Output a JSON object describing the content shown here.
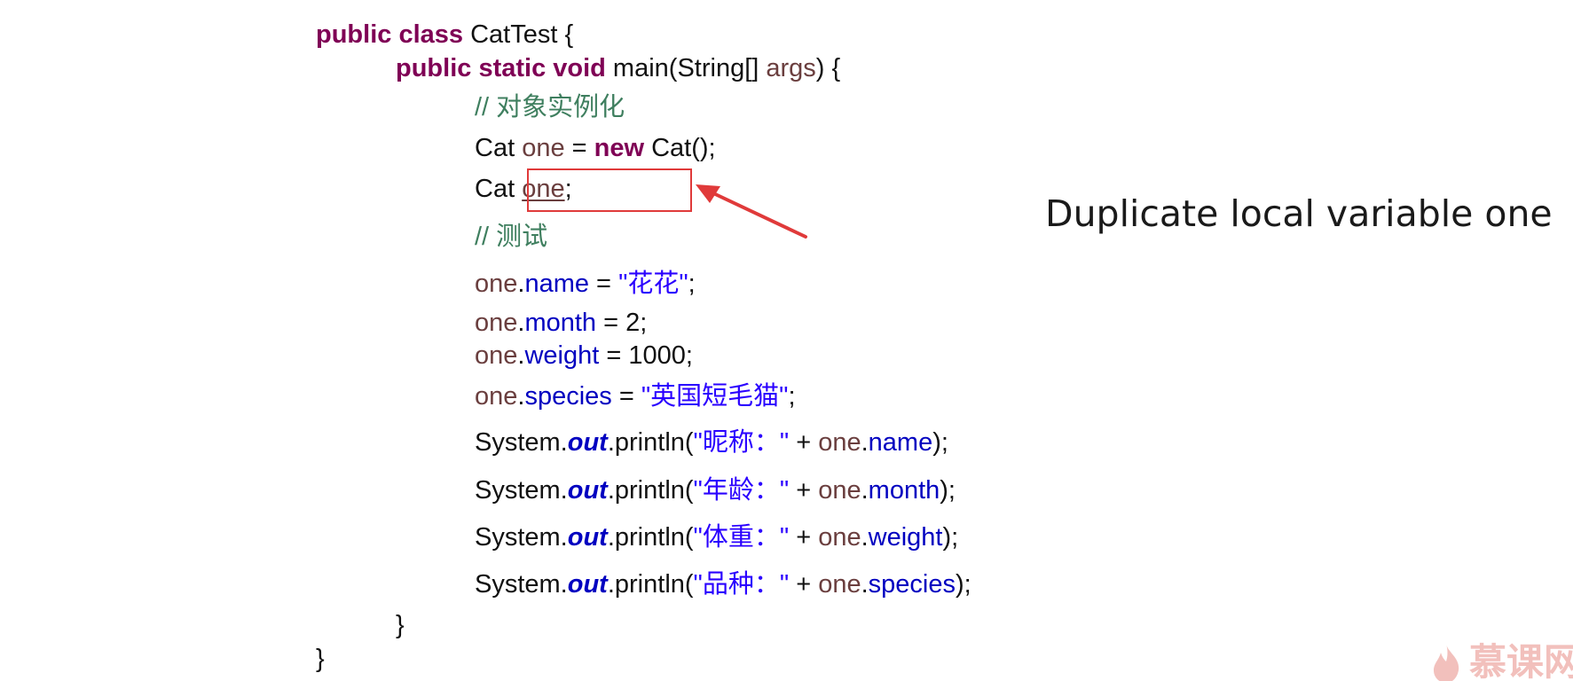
{
  "code": {
    "class_decl": {
      "kw": "public class",
      "name": " CatTest {"
    },
    "main_decl": {
      "kw": "public static void",
      "sig": " main(String[] ",
      "param": "args",
      "end": ") {"
    },
    "comment_instantiate": "// 对象实例化",
    "line_new": {
      "type": "Cat ",
      "var": "one",
      "eq": " = ",
      "kw": "new",
      "rest": " Cat();"
    },
    "line_dup": {
      "type": "Cat ",
      "var": "one",
      "end": ";"
    },
    "comment_test": "// 测试",
    "assign_name": {
      "obj": "one",
      "dot": ".",
      "field": "name",
      "eq": " = ",
      "value": "\"花花\"",
      "end": ";"
    },
    "assign_month": {
      "obj": "one",
      "dot": ".",
      "field": "month",
      "rest": " = 2;"
    },
    "assign_weight": {
      "obj": "one",
      "dot": ".",
      "field": "weight",
      "rest": " = 1000;"
    },
    "assign_species": {
      "obj": "one",
      "dot": ".",
      "field": "species",
      "eq": " = ",
      "value": "\"英国短毛猫\"",
      "end": ";"
    },
    "print_name": {
      "sys": "System.",
      "out": "out",
      "call": ".println(",
      "label": "\"昵称：\"",
      "plus": " + ",
      "obj": "one",
      "dot": ".",
      "field": "name",
      "end": ");"
    },
    "print_month": {
      "sys": "System.",
      "out": "out",
      "call": ".println(",
      "label": "\"年龄：\"",
      "plus": " + ",
      "obj": "one",
      "dot": ".",
      "field": "month",
      "end": ");"
    },
    "print_weight": {
      "sys": "System.",
      "out": "out",
      "call": ".println(",
      "label": "\"体重：\"",
      "plus": " + ",
      "obj": "one",
      "dot": ".",
      "field": "weight",
      "end": ");"
    },
    "print_species": {
      "sys": "System.",
      "out": "out",
      "call": ".println(",
      "label": "\"品种：\"",
      "plus": " + ",
      "obj": "one",
      "dot": ".",
      "field": "species",
      "end": ");"
    },
    "close_main": "}",
    "close_class": "}"
  },
  "annotation": {
    "error_message": "Duplicate local variable one",
    "box_color": "#e03a3a"
  },
  "watermark": {
    "text": "慕课网",
    "icon": "flame-icon"
  },
  "colors": {
    "keyword": "#7f0055",
    "local_var": "#6a3e3e",
    "field": "#0000c0",
    "string": "#2a00ff",
    "comment": "#3f7f5f"
  }
}
